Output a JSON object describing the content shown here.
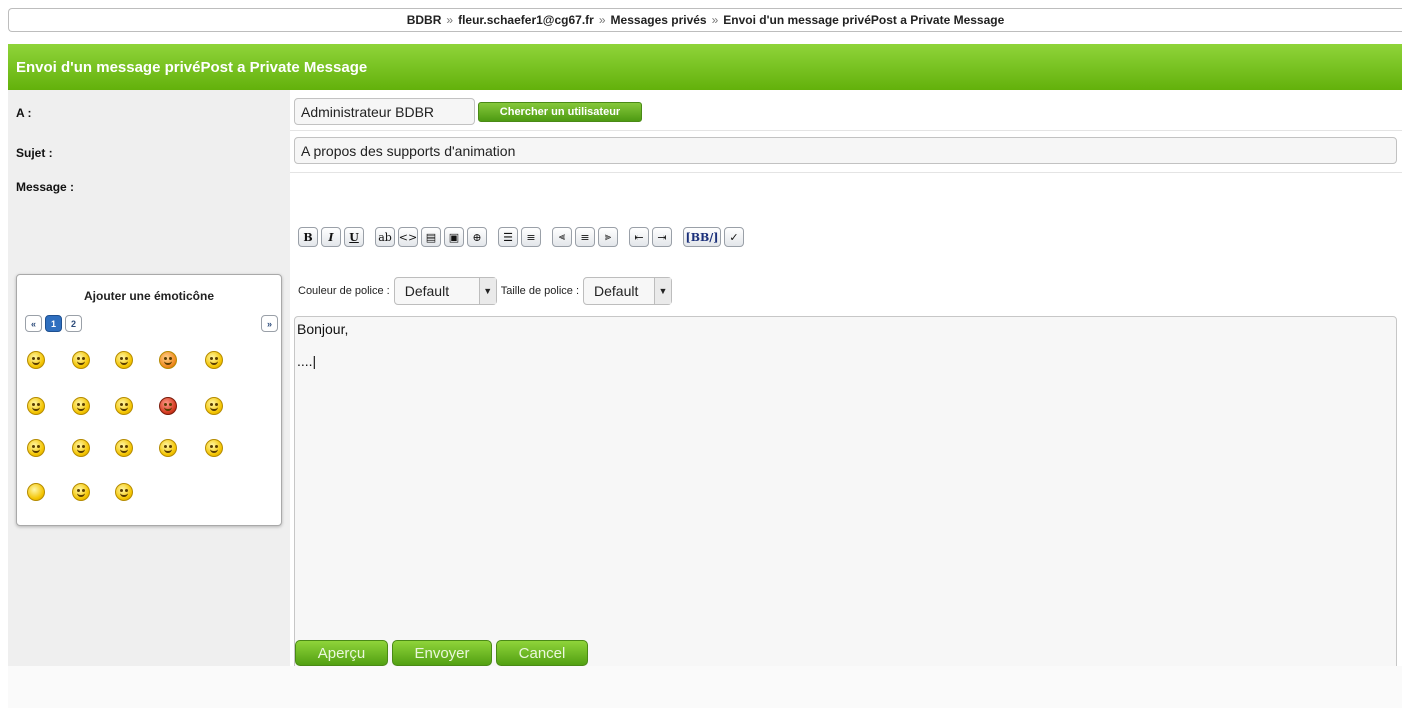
{
  "breadcrumb": {
    "items": [
      "BDBR",
      "fleur.schaefer1@cg67.fr",
      "Messages privés",
      "Envoi d'un message privéPost a Private Message"
    ],
    "separator": "»"
  },
  "panel": {
    "title": "Envoi d'un message privéPost a Private Message"
  },
  "form": {
    "to_label": "A :",
    "to_value": "Administrateur BDBR",
    "search_user_button": "Chercher un utilisateur",
    "subject_label": "Sujet :",
    "subject_value": "A propos des supports d'animation",
    "message_label": "Message :",
    "message_value": "Bonjour,\n\n....|"
  },
  "toolbar": {
    "buttons": [
      {
        "label": "B",
        "icon": "bold-icon"
      },
      {
        "label": "I",
        "icon": "italic-icon"
      },
      {
        "label": "U",
        "icon": "underline-icon"
      },
      {
        "label": "ab",
        "icon": "highlight-icon"
      },
      {
        "label": "<>",
        "icon": "code-icon"
      },
      {
        "label": "▤",
        "icon": "quote-icon"
      },
      {
        "label": "▣",
        "icon": "image-icon"
      },
      {
        "label": "⊕",
        "icon": "link-icon"
      },
      {
        "label": "☰",
        "icon": "bullet-list-icon"
      },
      {
        "label": "≡",
        "icon": "numbered-list-icon"
      },
      {
        "label": "⫷",
        "icon": "align-left-icon"
      },
      {
        "label": "≡",
        "icon": "align-center-icon"
      },
      {
        "label": "⫸",
        "icon": "align-right-icon"
      },
      {
        "label": "⇤",
        "icon": "outdent-icon"
      },
      {
        "label": "⇥",
        "icon": "indent-icon"
      },
      {
        "label": "[BB/]",
        "icon": "bbcode-toggle-icon"
      },
      {
        "label": "✓",
        "icon": "spellcheck-icon"
      }
    ],
    "font_color_label": "Couleur de police :",
    "font_color_value": "Default",
    "font_size_label": "Taille de police :",
    "font_size_value": "Default"
  },
  "emoticons": {
    "title": "Ajouter une émoticône",
    "prev": "«",
    "next": "»",
    "pages": [
      "1",
      "2"
    ],
    "current_page": "1",
    "items": [
      "angry-icon",
      "grin-icon",
      "neutral-icon",
      "surprised-icon",
      "confused-icon",
      "question-icon",
      "cool-icon",
      "eek-icon",
      "mad-icon",
      "dizzy-icon",
      "big-smile-icon",
      "sleepy-icon",
      "wondering-icon",
      "laugh-icon",
      "love-icon",
      "blank-icon",
      "sad-icon",
      "shocked-icon"
    ]
  },
  "actions": {
    "preview": "Aperçu",
    "send": "Envoyer",
    "cancel": "Cancel"
  }
}
